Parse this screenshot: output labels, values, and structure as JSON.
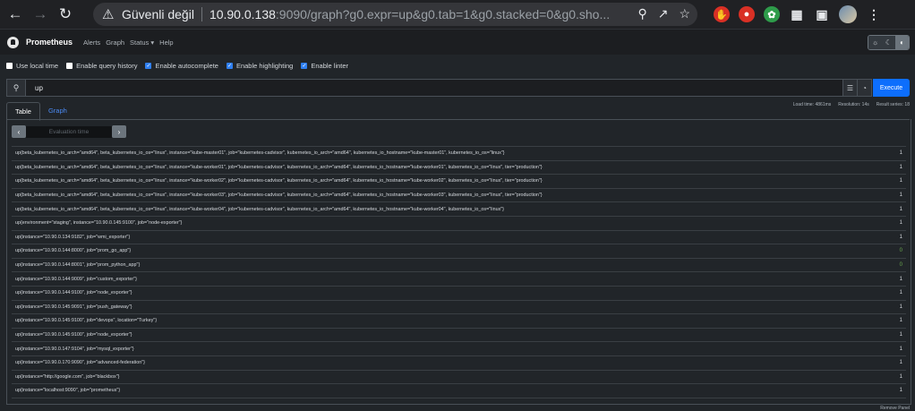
{
  "browser": {
    "security_label": "Güvenli değil",
    "url_host": "10.90.0.138",
    "url_rest": ":9090/graph?g0.expr=up&g0.tab=1&g0.stacked=0&g0.sho..."
  },
  "navbar": {
    "brand": "Prometheus",
    "links": [
      "Alerts",
      "Graph",
      "Status ▾",
      "Help"
    ]
  },
  "options": {
    "items": [
      {
        "label": "Use local time",
        "checked": false
      },
      {
        "label": "Enable query history",
        "checked": false
      },
      {
        "label": "Enable autocomplete",
        "checked": true
      },
      {
        "label": "Enable highlighting",
        "checked": true
      },
      {
        "label": "Enable linter",
        "checked": true
      }
    ]
  },
  "query": {
    "expression": "up",
    "execute_label": "Execute"
  },
  "stats": {
    "load_time": "Load time: 4861ms",
    "resolution": "Resolution: 14s",
    "result_series": "Result series: 18"
  },
  "tabs": {
    "table": "Table",
    "graph": "Graph"
  },
  "evaluation": {
    "placeholder": "Evaluation time"
  },
  "results": [
    {
      "metric": "up{beta_kubernetes_io_arch=\"amd64\", beta_kubernetes_io_os=\"linux\", instance=\"kube-master01\", job=\"kubernetes-cadvisor\", kubernetes_io_arch=\"amd64\", kubernetes_io_hostname=\"kube-master01\", kubernetes_io_os=\"linux\"}",
      "value": "1"
    },
    {
      "metric": "up{beta_kubernetes_io_arch=\"amd64\", beta_kubernetes_io_os=\"linux\", instance=\"kube-worker01\", job=\"kubernetes-cadvisor\", kubernetes_io_arch=\"amd64\", kubernetes_io_hostname=\"kube-worker01\", kubernetes_io_os=\"linux\", tier=\"production\"}",
      "value": "1"
    },
    {
      "metric": "up{beta_kubernetes_io_arch=\"amd64\", beta_kubernetes_io_os=\"linux\", instance=\"kube-worker02\", job=\"kubernetes-cadvisor\", kubernetes_io_arch=\"amd64\", kubernetes_io_hostname=\"kube-worker02\", kubernetes_io_os=\"linux\", tier=\"production\"}",
      "value": "1"
    },
    {
      "metric": "up{beta_kubernetes_io_arch=\"amd64\", beta_kubernetes_io_os=\"linux\", instance=\"kube-worker03\", job=\"kubernetes-cadvisor\", kubernetes_io_arch=\"amd64\", kubernetes_io_hostname=\"kube-worker03\", kubernetes_io_os=\"linux\", tier=\"production\"}",
      "value": "1"
    },
    {
      "metric": "up{beta_kubernetes_io_arch=\"amd64\", beta_kubernetes_io_os=\"linux\", instance=\"kube-worker04\", job=\"kubernetes-cadvisor\", kubernetes_io_arch=\"amd64\", kubernetes_io_hostname=\"kube-worker04\", kubernetes_io_os=\"linux\"}",
      "value": "1"
    },
    {
      "metric": "up{environment=\"staging\", instance=\"10.90.0.145:9100\", job=\"node-exporter\"}",
      "value": "1"
    },
    {
      "metric": "up{instance=\"10.90.0.134:9182\", job=\"wmi_exporter\"}",
      "value": "1"
    },
    {
      "metric": "up{instance=\"10.90.0.144:8000\", job=\"prom_go_app\"}",
      "value": "0"
    },
    {
      "metric": "up{instance=\"10.90.0.144:8001\", job=\"prom_python_app\"}",
      "value": "0"
    },
    {
      "metric": "up{instance=\"10.90.0.144:9009\", job=\"custom_exporter\"}",
      "value": "1"
    },
    {
      "metric": "up{instance=\"10.90.0.144:9100\", job=\"node_exporter\"}",
      "value": "1"
    },
    {
      "metric": "up{instance=\"10.90.0.145:9091\", job=\"push_gateway\"}",
      "value": "1"
    },
    {
      "metric": "up{instance=\"10.90.0.145:9100\", job=\"devops\", location=\"Turkey\"}",
      "value": "1"
    },
    {
      "metric": "up{instance=\"10.90.0.145:9100\", job=\"node_exporter\"}",
      "value": "1"
    },
    {
      "metric": "up{instance=\"10.90.0.147:9104\", job=\"mysql_exporter\"}",
      "value": "1"
    },
    {
      "metric": "up{instance=\"10.90.0.170:9090\", job=\"advanced-federation\"}",
      "value": "1"
    },
    {
      "metric": "up{instance=\"http://google.com\", job=\"blackbox\"}",
      "value": "1"
    },
    {
      "metric": "up{instance=\"localhost:9090\", job=\"prometheus\"}",
      "value": "1"
    }
  ],
  "remove_panel": "Remove Panel",
  "colors": {
    "accent": "#0d6efd",
    "background": "#212529",
    "navbar": "#1c1e21"
  }
}
